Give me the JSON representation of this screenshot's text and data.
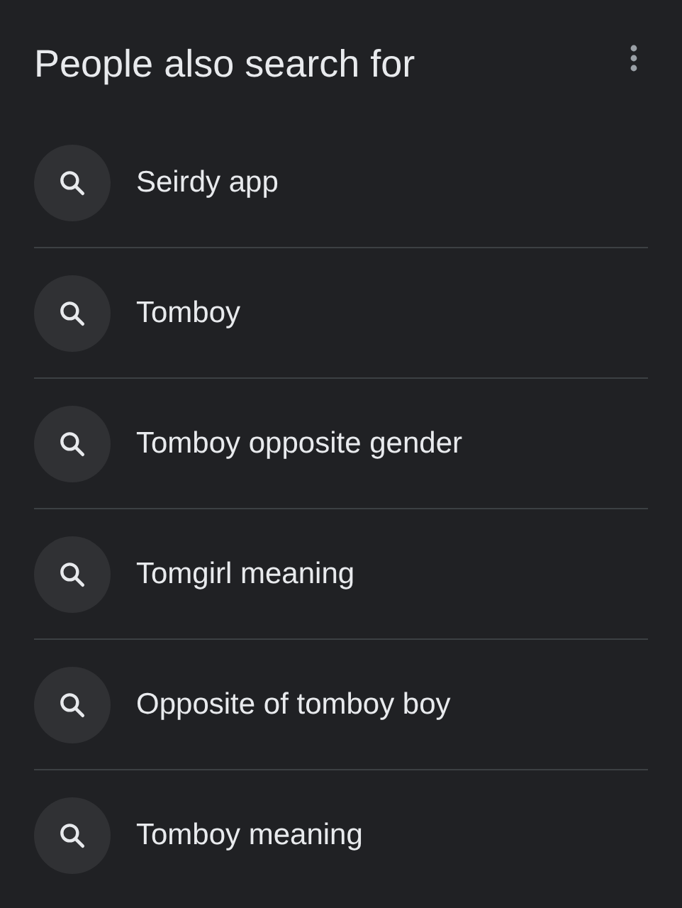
{
  "header": {
    "title": "People also search for"
  },
  "suggestions": [
    {
      "text": "Seirdy app"
    },
    {
      "text": "Tomboy"
    },
    {
      "text": "Tomboy opposite gender"
    },
    {
      "text": "Tomgirl meaning"
    },
    {
      "text": "Opposite of tomboy boy"
    },
    {
      "text": "Tomboy meaning"
    }
  ]
}
